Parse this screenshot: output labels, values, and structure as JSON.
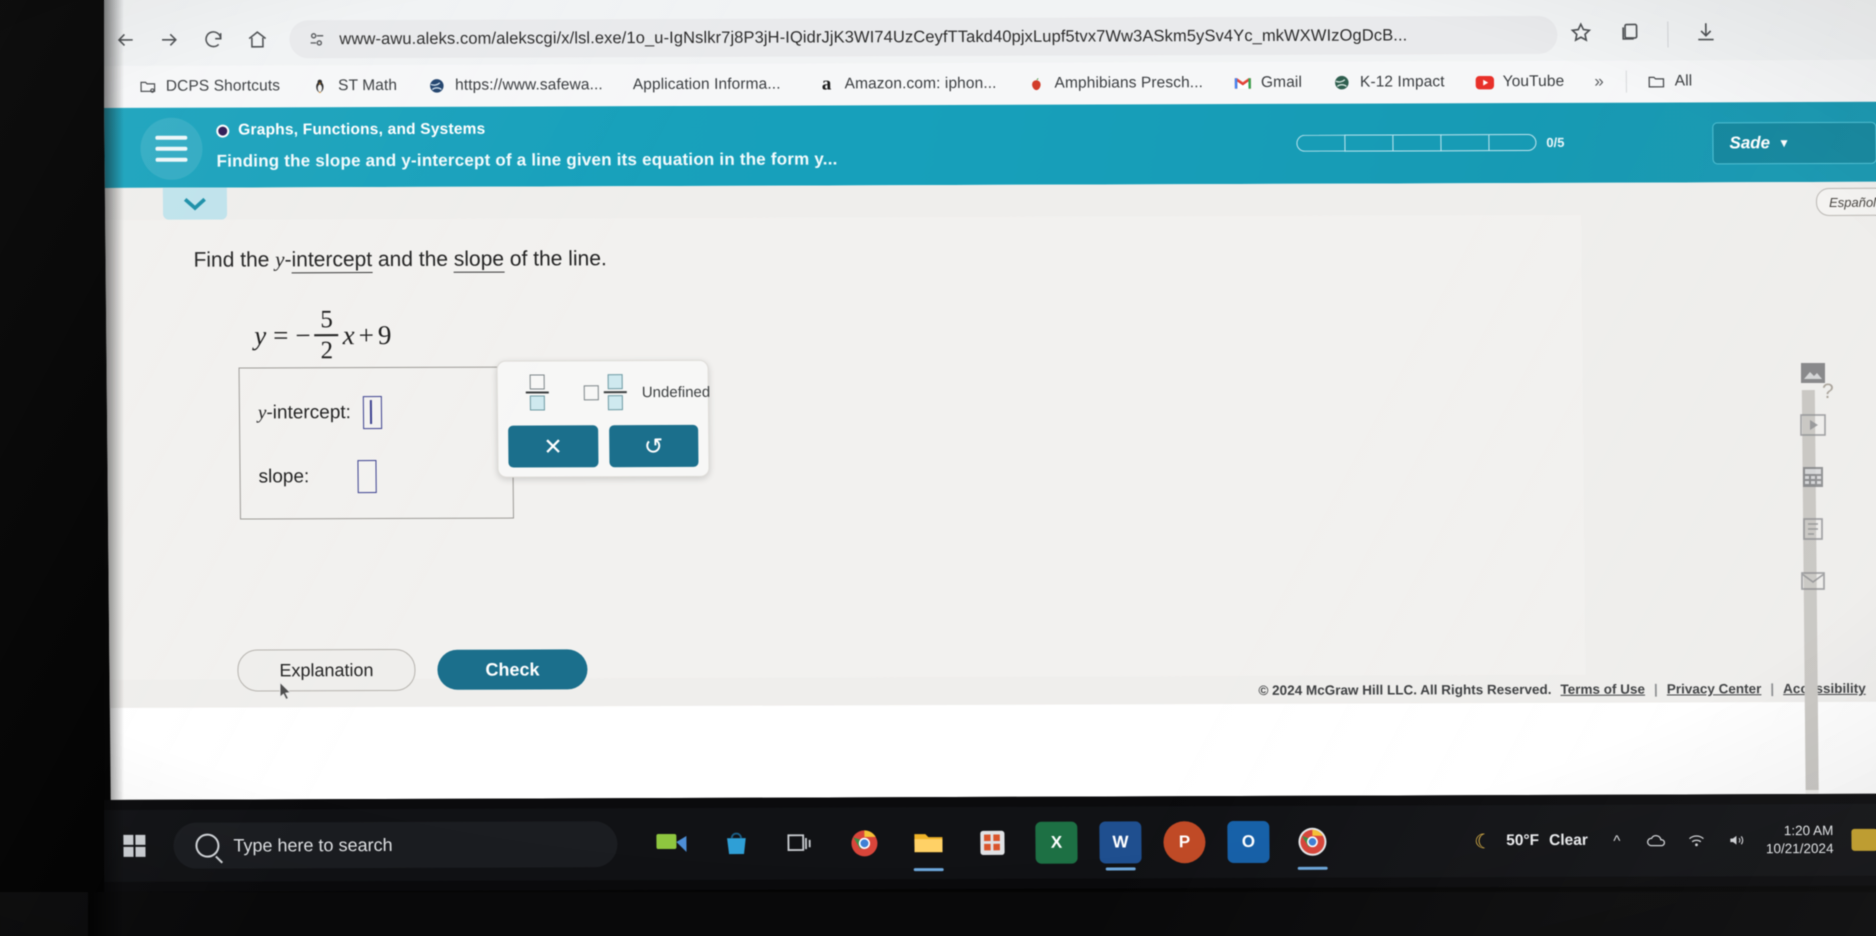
{
  "browser": {
    "nav": {
      "back_icon": "arrow-left-icon",
      "forward_icon": "arrow-right-icon",
      "reload_icon": "reload-icon",
      "home_icon": "home-icon"
    },
    "omnibox": {
      "site_icon": "site-settings-icon",
      "url": "www-awu.aleks.com/alekscgi/x/lsl.exe/1o_u-IgNslkr7j8P3jH-IQidrJjK3WI74UzCeyfTTakd40pjxLupf5tvx7Ww3ASkm5ySv4Yc_mkWXWIzOgDcB...",
      "bookmark_icon": "star-icon",
      "extensions_icon": "copy-icon",
      "download_icon": "download-icon"
    },
    "bookmarks": [
      {
        "label": "DCPS Shortcuts",
        "icon": "folder-gear-icon"
      },
      {
        "label": "ST Math",
        "icon": "penguin-icon"
      },
      {
        "label": "https://www.safewa...",
        "icon": "globe-icon"
      },
      {
        "label": "Application Informa...",
        "icon": "none"
      },
      {
        "label": "Amazon.com: iphon...",
        "icon": "amazon-icon"
      },
      {
        "label": "Amphibians Presch...",
        "icon": "apple-icon"
      },
      {
        "label": "Gmail",
        "icon": "gmail-icon"
      },
      {
        "label": "K-12 Impact",
        "icon": "globe-icon"
      },
      {
        "label": "YouTube",
        "icon": "youtube-icon"
      }
    ],
    "bookmarks_overflow": "»",
    "bookmarks_all": "All",
    "bookmarks_all_icon": "folder-icon"
  },
  "aleks": {
    "menu_icon": "hamburger-menu-icon",
    "topic": "Graphs, Functions, and Systems",
    "title": "Finding the slope and y-intercept of a line given its equation in the form y...",
    "progress": {
      "segments": 5,
      "filled": 0,
      "label": "0/5"
    },
    "user": {
      "name": "Sade",
      "chevron": "chevron-down-icon"
    },
    "collapse_icon": "chevron-down-icon",
    "language_button": "Español",
    "question": {
      "prompt_before": "Find the ",
      "prompt_y": "y",
      "prompt_dash": "-",
      "prompt_intercept": "intercept",
      "prompt_and": " and the ",
      "prompt_slope": "slope",
      "prompt_after": " of the line.",
      "equation": {
        "lhs": "y",
        "equals": "=",
        "sign": "−",
        "numerator": "5",
        "denominator": "2",
        "variable": "x",
        "plus": "+",
        "constant": "9",
        "plain": "y = -5/2 x + 9"
      },
      "answers": [
        {
          "label_italic": "y",
          "label_rest": "-intercept:",
          "value": ""
        },
        {
          "label_italic": "",
          "label_rest": "slope:",
          "value": ""
        }
      ]
    },
    "keypad": {
      "fraction_button": "fraction-template",
      "mixed_fraction_button": "mixed-number-template",
      "undefined_button": "Undefined",
      "clear_button_icon": "x-icon",
      "undo_button_icon": "undo-icon"
    },
    "buttons": {
      "explanation": "Explanation",
      "check": "Check"
    },
    "footer": {
      "copyright": "© 2024 McGraw Hill LLC. All Rights Reserved.",
      "links": [
        "Terms of Use",
        "Privacy Center",
        "Accessibility"
      ],
      "separator": "|"
    }
  },
  "right_rail": {
    "help": "?",
    "icons": [
      "image-icon",
      "video-icon",
      "calculator-icon",
      "notes-icon",
      "mail-icon"
    ]
  },
  "taskbar": {
    "start_icon": "windows-start-icon",
    "search": {
      "placeholder": "Type here to search",
      "icon": "search-icon"
    },
    "apps": [
      {
        "name": "task-view",
        "label": "",
        "color": "#4b8ed6"
      },
      {
        "name": "shopping-app",
        "label": "",
        "color": "#3aa0d8"
      },
      {
        "name": "task-view-icon",
        "label": "",
        "color": "#2f3338"
      },
      {
        "name": "chrome-pinned",
        "label": "",
        "color": "#2d7cd6"
      },
      {
        "name": "file-explorer",
        "label": "",
        "color": "#f0b429"
      },
      {
        "name": "store",
        "label": "",
        "color": "#dd5a2a"
      },
      {
        "name": "excel",
        "label": "X",
        "color": "#1d7044"
      },
      {
        "name": "word",
        "label": "W",
        "color": "#1f4f8f"
      },
      {
        "name": "powerpoint",
        "label": "P",
        "color": "#c04a26"
      },
      {
        "name": "outlook",
        "label": "O",
        "color": "#1660a8"
      },
      {
        "name": "chrome-active",
        "label": "",
        "color": "#f2f3f5"
      }
    ],
    "weather": {
      "icon": "moon-icon",
      "temperature": "50°F",
      "condition": "Clear"
    },
    "tray_icons": [
      "chevron-up-icon",
      "onedrive-icon",
      "network-icon",
      "volume-icon"
    ],
    "clock": {
      "time": "1:20 AM",
      "date": "10/21/2024"
    },
    "notification_icon": "notification-icon"
  },
  "colors": {
    "aleks_teal": "#17a2bc",
    "aleks_button": "#1b6f8c",
    "input_border": "#3a3f8f",
    "page_bg": "#efeeec"
  }
}
